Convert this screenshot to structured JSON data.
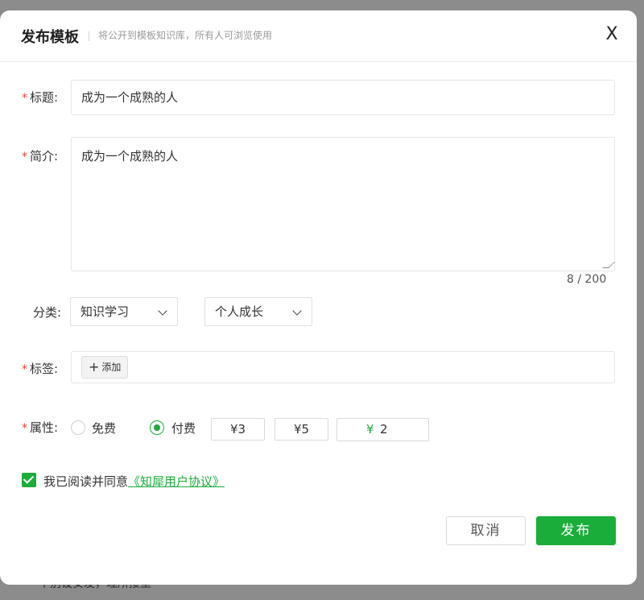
{
  "backdrop": {
    "text": "个别设安发，理所接里"
  },
  "modal": {
    "title": "发布模板",
    "subtitle": "将公开到模板知识库，所有人可浏览使用",
    "close_label": "X"
  },
  "form": {
    "title_label": "标题:",
    "title_value": "成为一个成熟的人",
    "desc_label": "简介:",
    "desc_value": "成为一个成熟的人",
    "desc_counter": "8 / 200",
    "category_label": "分类:",
    "category_primary": "知识学习",
    "category_secondary": "个人成长",
    "tags_label": "标签:",
    "add_tag_label": "添加",
    "attr_label": "属性:",
    "option_free": "免费",
    "option_paid": "付费",
    "selected_option": "付费",
    "price_options": [
      "¥3",
      "¥5"
    ],
    "custom_price_symbol": "¥",
    "custom_price_value": "2"
  },
  "agreement": {
    "checked": true,
    "text": "我已阅读并同意",
    "link": "《知犀用户协议》"
  },
  "buttons": {
    "cancel": "取消",
    "publish": "发布"
  },
  "colors": {
    "accent": "#1aad3a",
    "required": "#e8453c"
  }
}
